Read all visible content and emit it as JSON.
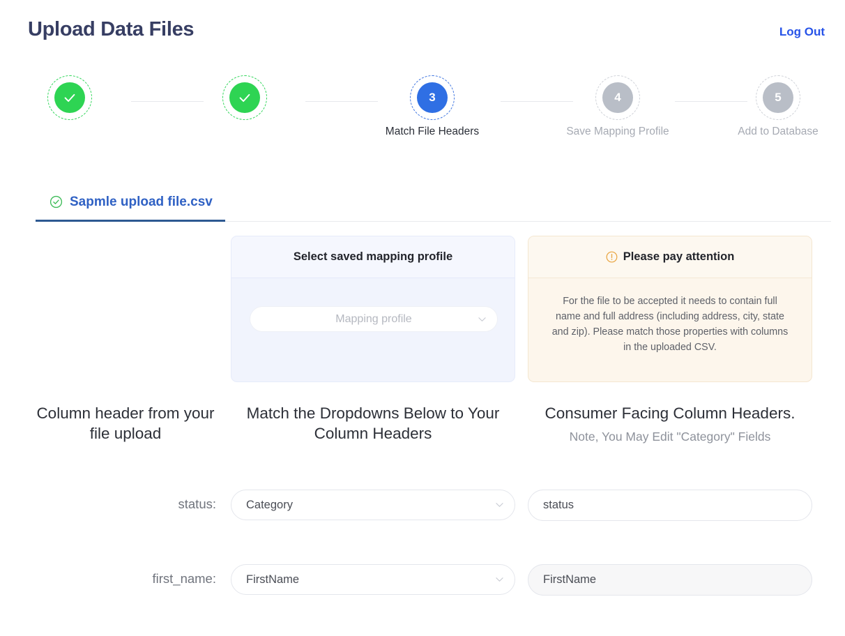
{
  "header": {
    "title": "Upload Data Files",
    "logout_label": "Log Out"
  },
  "stepper": {
    "steps": [
      {
        "number": "1",
        "label": "",
        "state": "done"
      },
      {
        "number": "2",
        "label": "",
        "state": "done"
      },
      {
        "number": "3",
        "label": "Match File Headers",
        "state": "current"
      },
      {
        "number": "4",
        "label": "Save Mapping Profile",
        "state": "todo"
      },
      {
        "number": "5",
        "label": "Add to Database",
        "state": "todo"
      }
    ]
  },
  "file_tab": {
    "label": "Sapmle upload file.csv",
    "icon": "check-circle-icon"
  },
  "profile_card": {
    "title": "Select saved mapping profile",
    "select_placeholder": "Mapping profile",
    "select_value": ""
  },
  "attention_card": {
    "icon": "exclamation-circle-icon",
    "title": "Please pay attention",
    "body": "For the file to be accepted it needs to contain full name and full address (including address, city, state and zip). Please match those properties with columns in the uploaded CSV."
  },
  "columns": {
    "left_heading": "Column header from your file upload",
    "middle_heading": "Match the Dropdowns Below to Your Column Headers",
    "right_heading": "Consumer Facing Column Headers.",
    "right_note": "Note, You May Edit \"Category\" Fields"
  },
  "mapping_rows": [
    {
      "source_label": "status:",
      "dropdown_value": "Category",
      "consumer_value": "status",
      "consumer_shaded": false
    },
    {
      "source_label": "first_name:",
      "dropdown_value": "FirstName",
      "consumer_value": "FirstName",
      "consumer_shaded": true
    }
  ],
  "colors": {
    "title": "#373e63",
    "link": "#2753e8",
    "done": "#2ed453",
    "current": "#2f6fe4",
    "todo": "#b9bec7",
    "tab_accent": "#2e5992",
    "profile_card_bg": "#f1f4fd",
    "attention_card_bg": "#fdf6ec",
    "attention_icon": "#e8a33d"
  }
}
